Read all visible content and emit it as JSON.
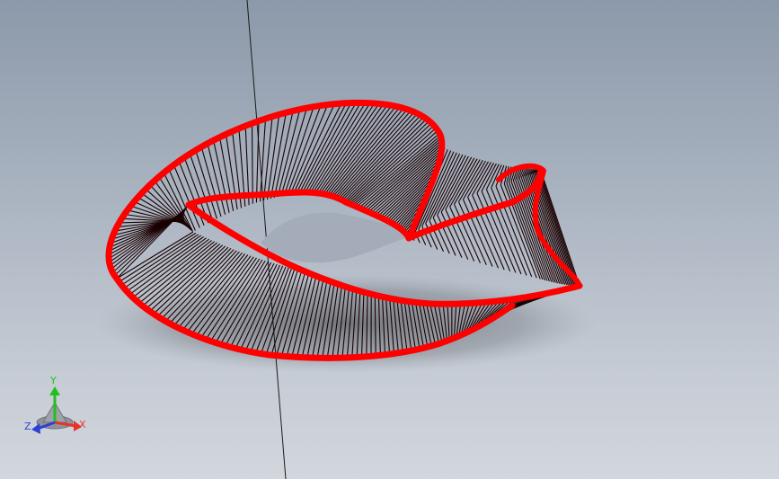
{
  "viewport": {
    "background_top": "#8c99aa",
    "background_bottom": "#d2d7de"
  },
  "model": {
    "edge_color": "#ff0000",
    "wire_color": "#1a0000",
    "shadow_color": "#6f747b"
  },
  "triad": {
    "x_label": "X",
    "y_label": "Y",
    "z_label": "Z",
    "x_color": "#e8322c",
    "y_color": "#22c01e",
    "z_color": "#2f3fd6"
  },
  "icons": [
    "triad-icon"
  ]
}
